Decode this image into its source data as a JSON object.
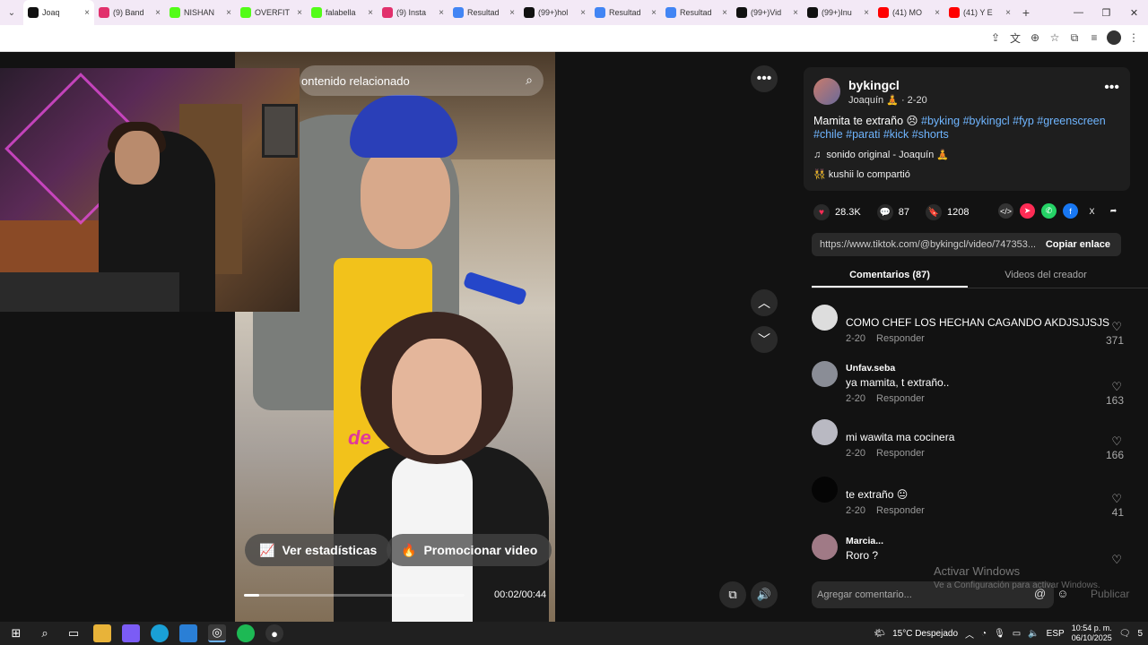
{
  "browser": {
    "tabs": [
      {
        "title": "Joaq",
        "color": "#111111",
        "active": true
      },
      {
        "title": "(9) Band",
        "color": "#e1306c"
      },
      {
        "title": "NISHAN",
        "color": "#53fc18"
      },
      {
        "title": "OVERFIT",
        "color": "#53fc18"
      },
      {
        "title": "falabella",
        "color": "#53fc18"
      },
      {
        "title": "(9) Insta",
        "color": "#e1306c"
      },
      {
        "title": "Resultad",
        "color": "#4285f4"
      },
      {
        "title": "(99+)hol",
        "color": "#111111"
      },
      {
        "title": "Resultad",
        "color": "#4285f4"
      },
      {
        "title": "Resultad",
        "color": "#4285f4"
      },
      {
        "title": "(99+)Vid",
        "color": "#111111"
      },
      {
        "title": "(99+)Inu",
        "color": "#111111"
      },
      {
        "title": "(41) MO",
        "color": "#ff0000"
      },
      {
        "title": "(41) Y E",
        "color": "#ff0000"
      }
    ],
    "tab_close": "×",
    "new_tab": "+",
    "window_controls": {
      "minimize": "—",
      "maximize": "❐",
      "close": "✕"
    }
  },
  "video": {
    "related_search": "ontenido relacionado",
    "overlay_word": "de",
    "stats_button": "Ver estadísticas",
    "promote_button": "Promocionar video",
    "time": "00:02/00:44",
    "progress_fraction": 0.07
  },
  "post": {
    "username": "bykingcl",
    "display": "Joaquín 🧘 · 2-20",
    "description_text": "Mamita te extraño 😣 ",
    "hashtags": "#byking #bykingcl #fyp #greenscreen #chile #parati #kick #shorts",
    "music": "sonido original - Joaquín 🧘",
    "shared_by": "kushii lo compartió",
    "likes": "28.3K",
    "comments": "87",
    "saves": "1208",
    "link": "https://www.tiktok.com/@bykingcl/video/747353...",
    "copy_link": "Copiar enlace",
    "tab_comments": "Comentarios (87)",
    "tab_creator": "Videos del creador"
  },
  "comments": [
    {
      "user": "",
      "text": "COMO CHEF LOS HECHAN CAGANDO AKDJSJJSJS",
      "date": "2-20",
      "reply": "Responder",
      "likes": "371",
      "avatar": "#dddddd"
    },
    {
      "user": "Unfav.seba",
      "text": "ya mamita, t extraño..",
      "date": "2-20",
      "reply": "Responder",
      "likes": "163",
      "avatar": "#8a8d96"
    },
    {
      "user": "",
      "text": "mi wawita ma cocinera",
      "date": "2-20",
      "reply": "Responder",
      "likes": "166",
      "avatar": "#b9b9c2"
    },
    {
      "user": "",
      "text": "te extraño 😐",
      "date": "2-20",
      "reply": "Responder",
      "likes": "41",
      "avatar": "#050505"
    },
    {
      "user": "Marcia...",
      "text": "Roro ?",
      "date": "",
      "reply": "",
      "likes": "",
      "avatar": "#a07a86"
    }
  ],
  "composer": {
    "placeholder": "Agregar comentario...",
    "publish": "Publicar"
  },
  "watermark": {
    "title": "Activar Windows",
    "subtitle": "Ve a Configuración para activar Windows."
  },
  "taskbar": {
    "weather": "15°C  Despejado",
    "lang": "ESP",
    "time": "10:54 p. m.",
    "date": "06/10/2025",
    "notifications": "5"
  }
}
